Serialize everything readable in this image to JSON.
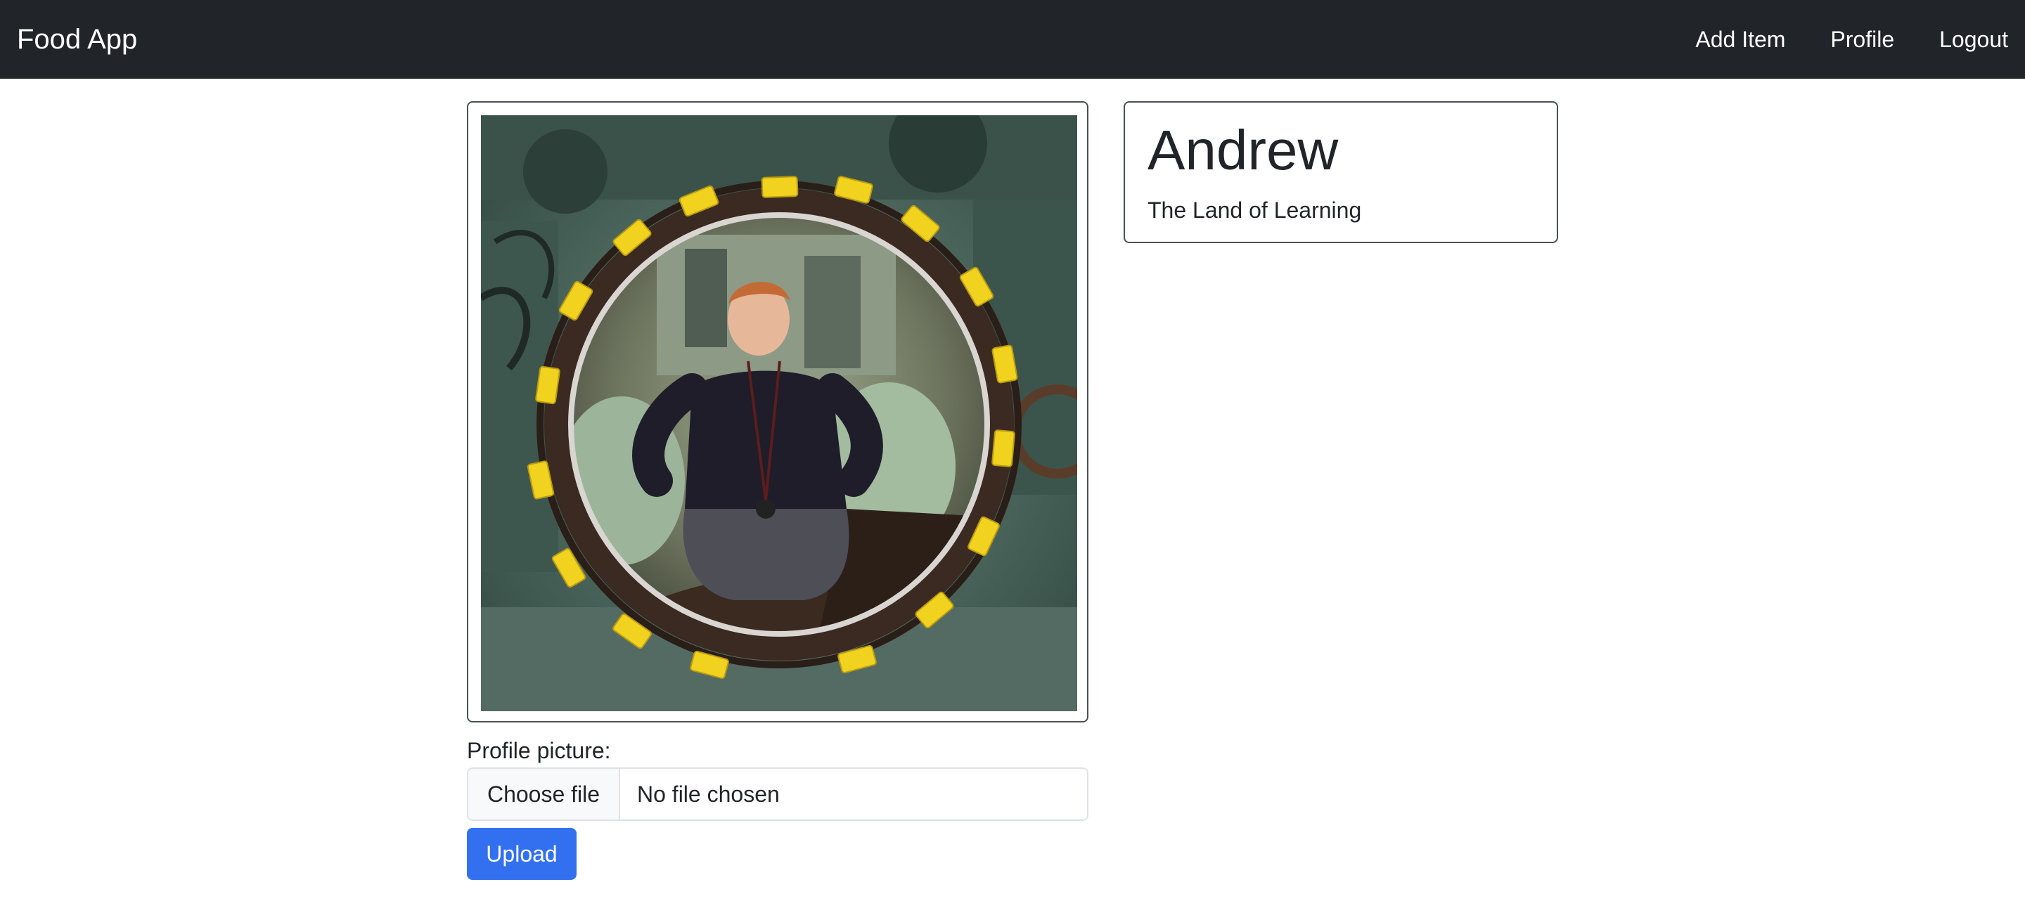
{
  "navbar": {
    "brand": "Food App",
    "links": [
      "Add Item",
      "Profile",
      "Logout"
    ]
  },
  "profile": {
    "name": "Andrew",
    "location": "The Land of Learning"
  },
  "upload": {
    "label": "Profile picture:",
    "choose_button": "Choose file",
    "file_status": "No file chosen",
    "submit_label": "Upload"
  },
  "colors": {
    "navbar_bg": "#212529",
    "primary": "#3270f0"
  }
}
